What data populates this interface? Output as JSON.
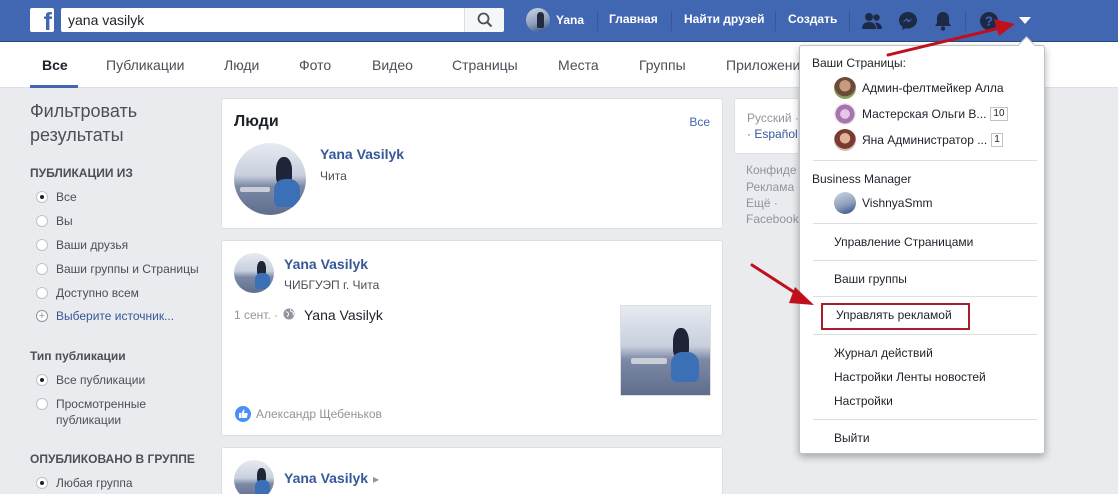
{
  "header": {
    "logo_letter": "f",
    "search_value": "yana vasilyk",
    "user_name": "Yana",
    "nav_links": [
      "Главная",
      "Найти друзей",
      "Создать"
    ]
  },
  "tabs": [
    "Все",
    "Публикации",
    "Люди",
    "Фото",
    "Видео",
    "Страницы",
    "Места",
    "Группы",
    "Приложения"
  ],
  "filters": {
    "title": "Фильтровать результаты",
    "from_header": "ПУБЛИКАЦИИ ИЗ",
    "from_options": [
      "Все",
      "Вы",
      "Ваши друзья",
      "Ваши группы и Страницы",
      "Доступно всем"
    ],
    "choose_source": "Выберите источник...",
    "type_header": "Тип публикации",
    "type_options": [
      "Все публикации",
      "Просмотренные публикации"
    ],
    "group_header": "ОПУБЛИКОВАНО В ГРУППЕ",
    "group_options": [
      "Любая группа"
    ]
  },
  "people_card": {
    "title": "Люди",
    "see_all": "Все",
    "name": "Yana Vasilyk",
    "city": "Чита"
  },
  "post": {
    "name": "Yana Vasilyk",
    "subtitle": "ЧИБГУЭП г. Чита",
    "date": "1 сент. ·",
    "text": "Yana Vasilyk",
    "liker": "Александр Щебеньков"
  },
  "post2": {
    "name": "Yana Vasilyk",
    "arrow": "▸"
  },
  "right_column": {
    "lang_current": "Русский ·",
    "lang_other": "· Español",
    "links": [
      "Конфиде",
      "Реклама ·",
      "Ещё ·",
      "Facebook"
    ]
  },
  "dropdown": {
    "pages_header": "Ваши Страницы:",
    "pages": [
      {
        "name": "Админ-фелтмейкер Алла",
        "badge": ""
      },
      {
        "name": "Мастерская Ольги В...",
        "badge": "10"
      },
      {
        "name": "Яна Администратор ...",
        "badge": "1"
      }
    ],
    "bm_header": "Business Manager",
    "bm_account": "VishnyaSmm",
    "manage_pages": "Управление Страницами",
    "your_groups": "Ваши группы",
    "manage_ads": "Управлять рекламой",
    "activity_log": "Журнал действий",
    "news_feed_prefs": "Настройки Ленты новостей",
    "settings": "Настройки",
    "logout": "Выйти"
  },
  "colors": {
    "brand_blue": "#4267b2",
    "annotation_red": "#c0101e"
  }
}
